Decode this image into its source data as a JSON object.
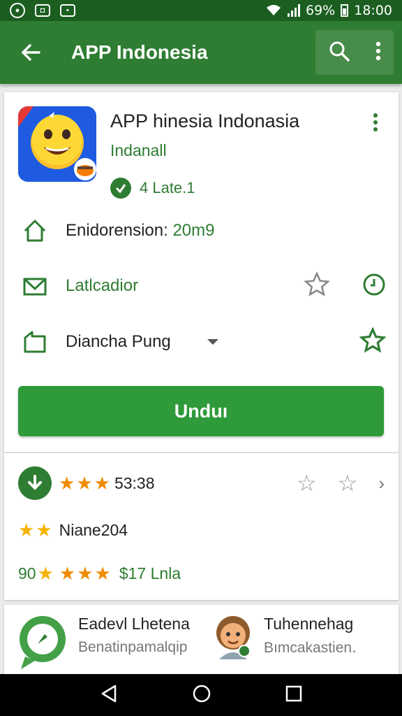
{
  "status_bar": {
    "battery": "69%",
    "time": "18:00",
    "icons": [
      "whatsapp-icon",
      "photo-icon",
      "message-icon",
      "wifi-icon",
      "signal-icon",
      "battery-icon"
    ]
  },
  "app_bar": {
    "title": "APP Indonesia",
    "icons": [
      "back-arrow-icon",
      "search-icon",
      "more-vert-icon"
    ]
  },
  "app_card": {
    "name": "APP hinesia Indonasia",
    "developer": "Indanall",
    "rating_label": "4 Late.1",
    "rows": [
      {
        "label": "Enidorension: ",
        "value": "20m9",
        "icon": "home-icon"
      },
      {
        "label": "Latlcadior",
        "icon": "mail-icon",
        "right_icons": [
          "star-outline-icon",
          "clock-icon"
        ]
      },
      {
        "label": "Diancha Pung",
        "icon": "folder-icon",
        "right_icons": [
          "star-outline-icon"
        ]
      }
    ],
    "install_label": "Unduı"
  },
  "ratings_card": {
    "line1_text": "53:38",
    "line2_text": "Niane204",
    "line3_prefix": "90",
    "line3_text": "$17 Lnla"
  },
  "related_apps": [
    {
      "title": "Eadevl Lhetena",
      "subtitle": "Benatinpamalqip"
    },
    {
      "title": "Tuhennehag",
      "subtitle": "Bımcakastien․"
    }
  ],
  "colors": {
    "status_bar": "#1b5e20",
    "app_bar": "#2e7d32",
    "accent": "#2e7d32",
    "install_button": "#2e9a3a",
    "star_orange": "#ef8c00",
    "star_yellow": "#f5b400"
  },
  "nav_bar": {
    "icons": [
      "nav-back-icon",
      "nav-home-icon",
      "nav-recents-icon"
    ]
  }
}
